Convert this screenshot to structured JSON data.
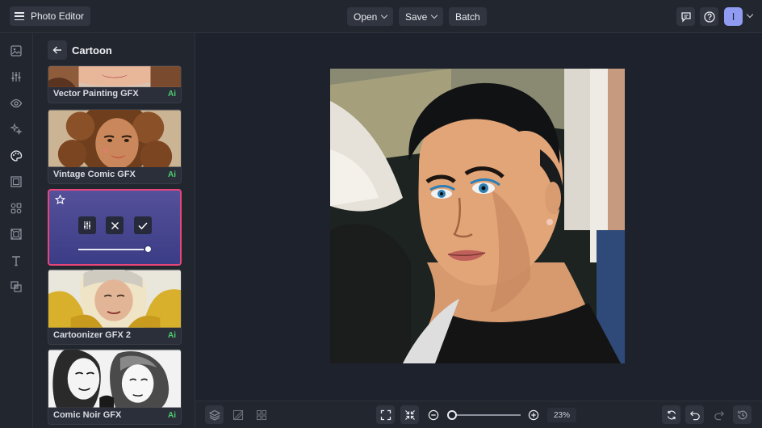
{
  "topbar": {
    "app_title": "Photo Editor",
    "open_label": "Open",
    "save_label": "Save",
    "batch_label": "Batch",
    "avatar_letter": "I"
  },
  "rail": {
    "icons": [
      "image-icon",
      "adjust-icon",
      "eye-icon",
      "effects-icon",
      "palette-icon",
      "frame-icon",
      "graphics-icon",
      "texture-icon",
      "text-icon",
      "overlay-icon"
    ],
    "active": "palette-icon"
  },
  "panel": {
    "title": "Cartoon",
    "cards": [
      {
        "label": "Vector Painting GFX",
        "badge": "Ai"
      },
      {
        "label": "Vintage Comic GFX",
        "badge": "Ai"
      },
      {
        "label": "",
        "badge": "",
        "active": true,
        "intensity": 1.0
      },
      {
        "label": "Cartoonizer GFX 2",
        "badge": "Ai"
      },
      {
        "label": "Comic Noir GFX",
        "badge": "Ai"
      }
    ]
  },
  "bottombar": {
    "zoom_value": "23%",
    "zoom_level": 0.0
  },
  "colors": {
    "accent": "#e8467a",
    "ai_badge": "#4ecb71",
    "avatar": "#8f9cf2",
    "background": "#1e222c"
  }
}
